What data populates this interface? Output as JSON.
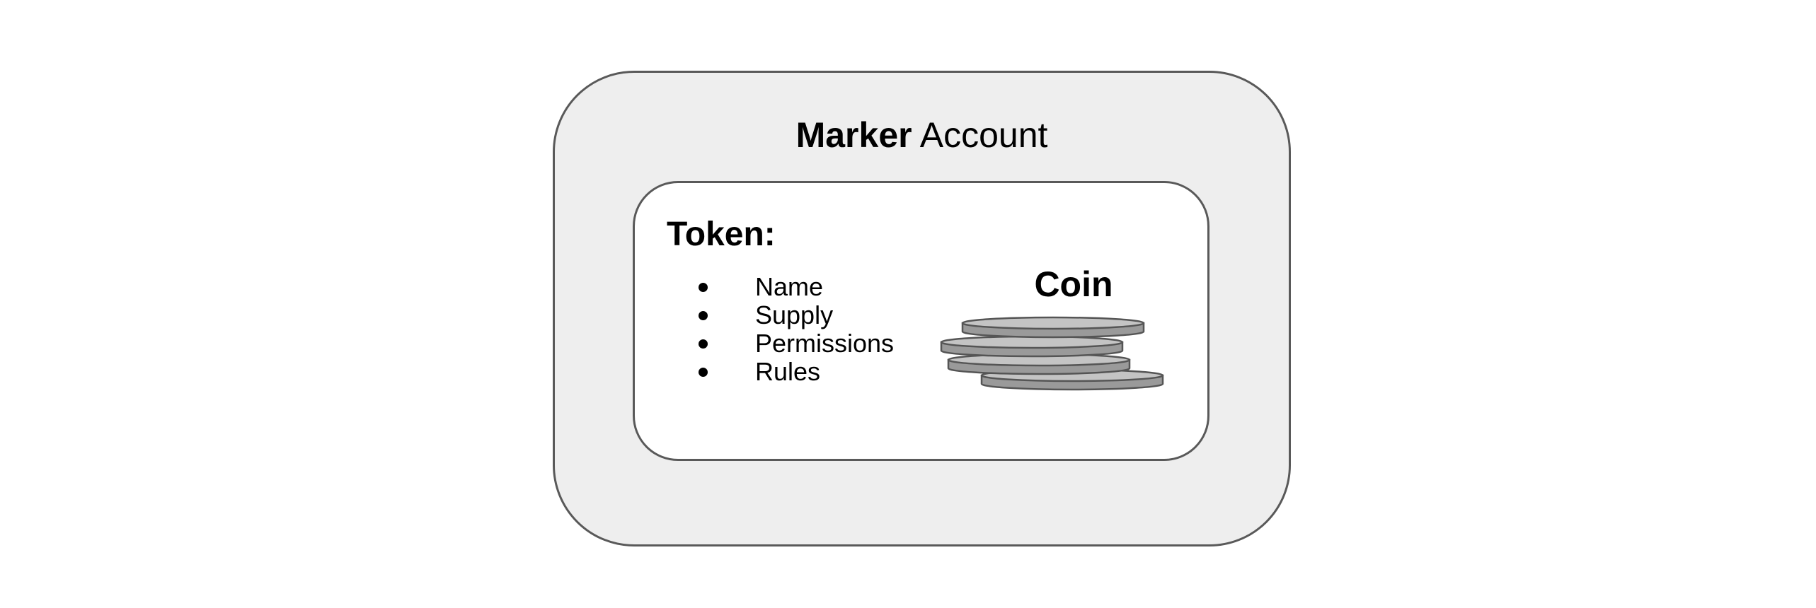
{
  "account": {
    "title_bold": "Marker",
    "title_rest": "Account"
  },
  "token": {
    "heading": "Token:",
    "items": [
      "Name",
      "Supply",
      "Permissions",
      "Rules"
    ]
  },
  "coin": {
    "label": "Coin",
    "icon": "coin-stack-icon"
  },
  "colors": {
    "outer_fill": "#eeeeee",
    "border": "#595959",
    "coin_top": "#c4c4c4",
    "coin_side": "#9a9a9a",
    "coin_edge": "#555555"
  }
}
